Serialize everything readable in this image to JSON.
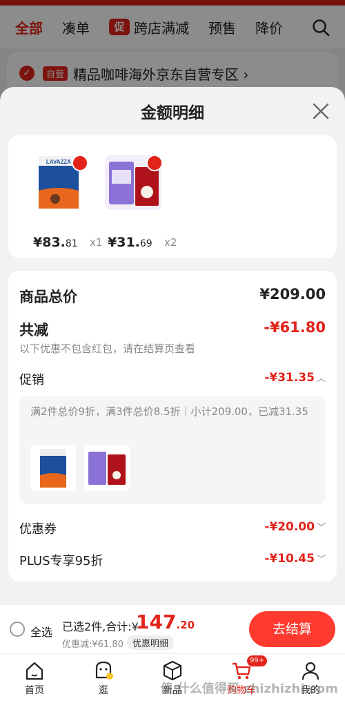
{
  "nav": {
    "tabs": [
      "全部",
      "凑单",
      "跨店满减",
      "预售",
      "降价"
    ],
    "promo_badge": "促"
  },
  "store": {
    "self_tag": "自营",
    "name": "精品咖啡海外京东自营专区 ›"
  },
  "sheet": {
    "title": "金额明细",
    "goods": [
      {
        "price_int": "¥83.",
        "price_dec": "81",
        "qty": "x1"
      },
      {
        "price_int": "¥31.",
        "price_dec": "69",
        "qty": "x2"
      }
    ],
    "total_label": "商品总价",
    "total_value": "¥209.00",
    "reduce_label": "共减",
    "reduce_value": "-¥61.80",
    "reduce_note": "以下优惠不包含红包，请在结算页查看",
    "promo_label": "促销",
    "promo_value": "-¥31.35",
    "promo_desc": "满2件总价9折，满3件总价8.5折｜小计209.00，已减31.35",
    "coupon_label": "优惠券",
    "coupon_value": "-¥20.00",
    "plus_label": "PLUS专享95折",
    "plus_value": "-¥10.45"
  },
  "checkout": {
    "select_all": "全选",
    "selected_text": "已选2件,合计:¥",
    "total_int": "147",
    "total_dec": ".20",
    "discount_text": "优惠减:¥61.80",
    "detail_link": "优惠明细",
    "button": "去结算"
  },
  "tabbar": [
    "首页",
    "逛",
    "新品",
    "购物车",
    "我的"
  ],
  "cart_badge": "99+",
  "watermark": "值 什么值得买 zhizhizhi.com",
  "colors": {
    "accent": "#e2231a",
    "button": "#ff3b30"
  }
}
